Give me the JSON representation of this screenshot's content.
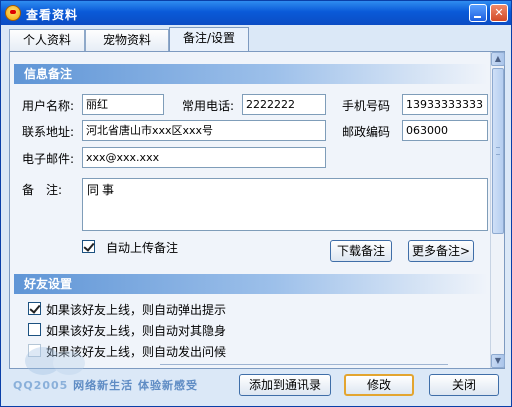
{
  "window": {
    "title": "查看资料"
  },
  "tabs": [
    {
      "label": "个人资料"
    },
    {
      "label": "宠物资料"
    },
    {
      "label": "备注/设置"
    }
  ],
  "info_section": {
    "title": "信息备注",
    "name_label": "用户名称:",
    "name_value": "丽红",
    "phone_label": "常用电话:",
    "phone_value": "2222222",
    "mobile_label": "手机号码",
    "mobile_value": "13933333333",
    "address_label": "联系地址:",
    "address_value": "河北省唐山市xxx区xxx号",
    "zip_label": "邮政编码",
    "zip_value": "063000",
    "email_label": "电子邮件:",
    "email_value": "xxx@xxx.xxx",
    "remark_label": "备　注:",
    "remark_value": "同事",
    "auto_upload_label": "自动上传备注",
    "auto_upload_checked": true,
    "download_button": "下载备注",
    "more_button": "更多备注>"
  },
  "friend_section": {
    "title": "好友设置",
    "options": [
      {
        "label": "如果该好友上线，则自动弹出提示",
        "checked": true
      },
      {
        "label": "如果该好友上线，则自动对其隐身",
        "checked": false
      },
      {
        "label": "如果该好友上线，则自动发出问候",
        "checked": false
      }
    ]
  },
  "footer": {
    "slogan_brand": "QQ2005",
    "slogan_text": "网络新生活  体验新感受",
    "add_button": "添加到通讯录",
    "modify_button": "修改",
    "close_button": "关闭"
  },
  "colors": {
    "titlebar": "#0b4cc4",
    "section_header": "#5f95d6",
    "window_bg": "#dbe8f7"
  }
}
